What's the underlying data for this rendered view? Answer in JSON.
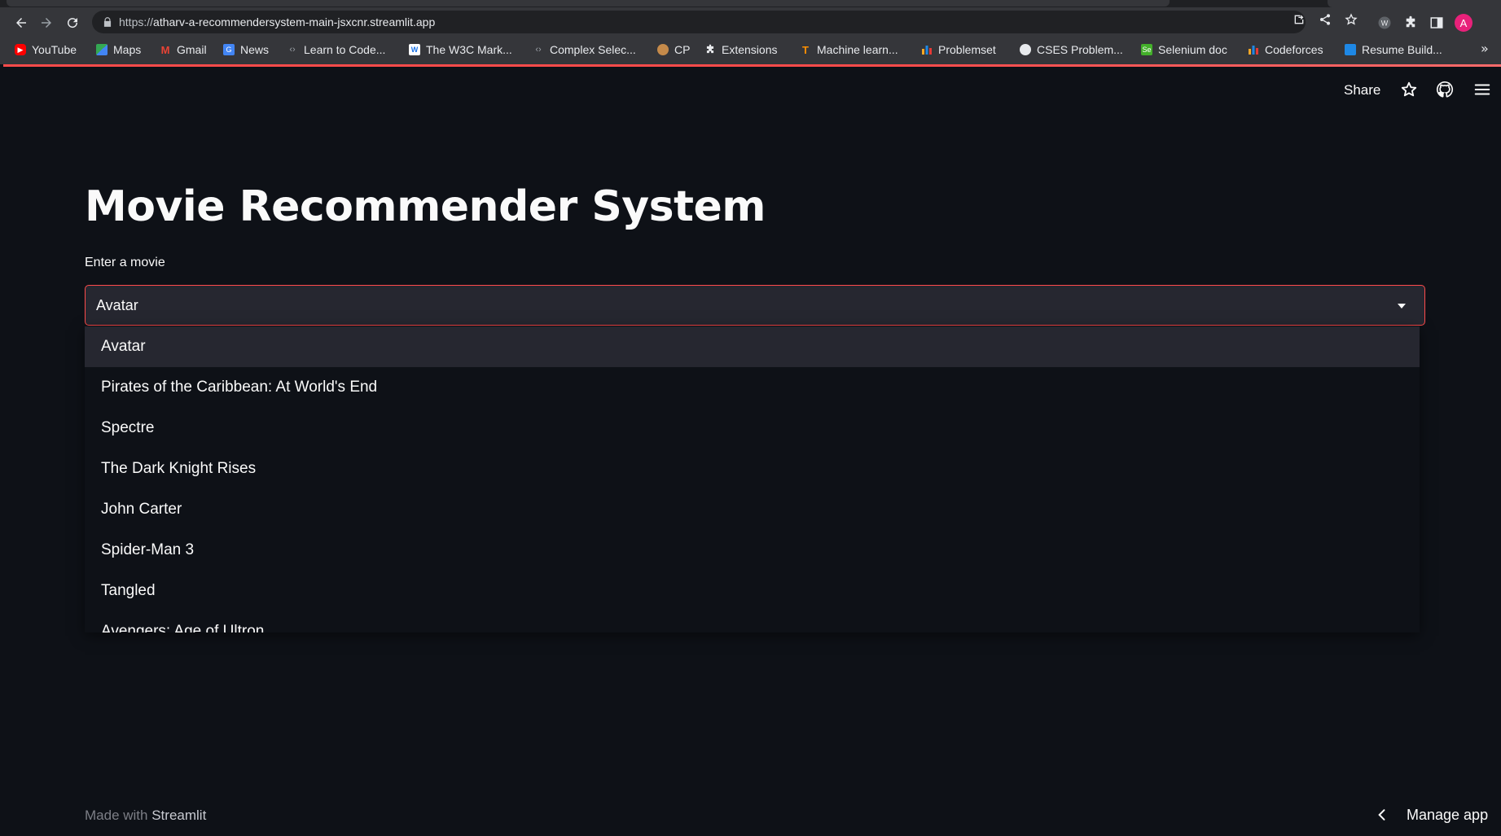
{
  "browser": {
    "url_scheme": "https://",
    "url_host": "atharv-a-recommendersystem-main-jsxcnr.streamlit.app",
    "profile_initial": "A",
    "bookmarks": [
      {
        "label": "YouTube",
        "icon": "youtube-icon",
        "color": "#ff0000"
      },
      {
        "label": "Maps",
        "icon": "maps-icon",
        "color": "#34a853"
      },
      {
        "label": "Gmail",
        "icon": "gmail-icon",
        "color": "#ea4335"
      },
      {
        "label": "News",
        "icon": "news-icon",
        "color": "#4285f4"
      },
      {
        "label": "Learn to Code...",
        "icon": "code-icon",
        "color": "#9aa0a6"
      },
      {
        "label": "The W3C Mark...",
        "icon": "w3c-icon",
        "color": "#1a73e8"
      },
      {
        "label": "Complex Selec...",
        "icon": "code-icon",
        "color": "#9aa0a6"
      },
      {
        "label": "CP",
        "icon": "cp-icon",
        "color": "#c58a4a"
      },
      {
        "label": "Extensions",
        "icon": "puzzle-icon",
        "color": "#e8eaed"
      },
      {
        "label": "Machine learn...",
        "icon": "tensorflow-icon",
        "color": "#ff8f00"
      },
      {
        "label": "Problemset",
        "icon": "codeforces-icon",
        "color": "#f9a825"
      },
      {
        "label": "CSES Problem...",
        "icon": "globe-icon",
        "color": "#e8eaed"
      },
      {
        "label": "Selenium doc",
        "icon": "selenium-icon",
        "color": "#43b02a"
      },
      {
        "label": "Codeforces",
        "icon": "codeforces-icon",
        "color": "#f9a825"
      },
      {
        "label": "Resume Build...",
        "icon": "resume-icon",
        "color": "#1e88e5"
      }
    ],
    "more_label": "»"
  },
  "app": {
    "header": {
      "share_label": "Share"
    },
    "title": "Movie Recommender System",
    "select": {
      "label": "Enter a movie",
      "selected_value": "Avatar",
      "options": [
        "Avatar",
        "Pirates of the Caribbean: At World's End",
        "Spectre",
        "The Dark Knight Rises",
        "John Carter",
        "Spider-Man 3",
        "Tangled",
        "Avengers: Age of Ultron"
      ]
    },
    "footer": {
      "made_with": "Made with",
      "brand": "Streamlit",
      "manage_app": "Manage app"
    }
  },
  "colors": {
    "accent": "#ff4b4b",
    "background": "#0e1117",
    "input_bg": "#262730"
  }
}
